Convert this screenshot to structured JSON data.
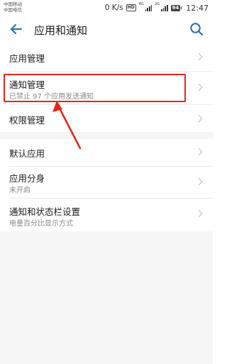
{
  "status_bar": {
    "carrier_1": "中国移动",
    "carrier_2": "中国电信",
    "speed": "0 K/s",
    "hd_label": "HD",
    "net_1": "4G",
    "net_2": "2G",
    "battery": "94",
    "time": "12:47"
  },
  "header": {
    "title": "应用和通知",
    "back_icon": "arrow-left-icon",
    "search_icon": "search-icon"
  },
  "sections": {
    "group_1": [
      {
        "title": "应用管理",
        "subtitle": ""
      },
      {
        "title": "通知管理",
        "subtitle": "已禁止 97 个应用发送通知"
      },
      {
        "title": "权限管理",
        "subtitle": ""
      }
    ],
    "group_2": [
      {
        "title": "默认应用",
        "subtitle": ""
      },
      {
        "title": "应用分身",
        "subtitle": "未开启"
      },
      {
        "title": "通知和状态栏设置",
        "subtitle": "电量百分比显示方式"
      }
    ]
  },
  "colors": {
    "accent": "#1f6fb7",
    "annotation": "#e2261b",
    "section_gap": "#f5f5f5",
    "subtitle": "#8a8a8a"
  }
}
